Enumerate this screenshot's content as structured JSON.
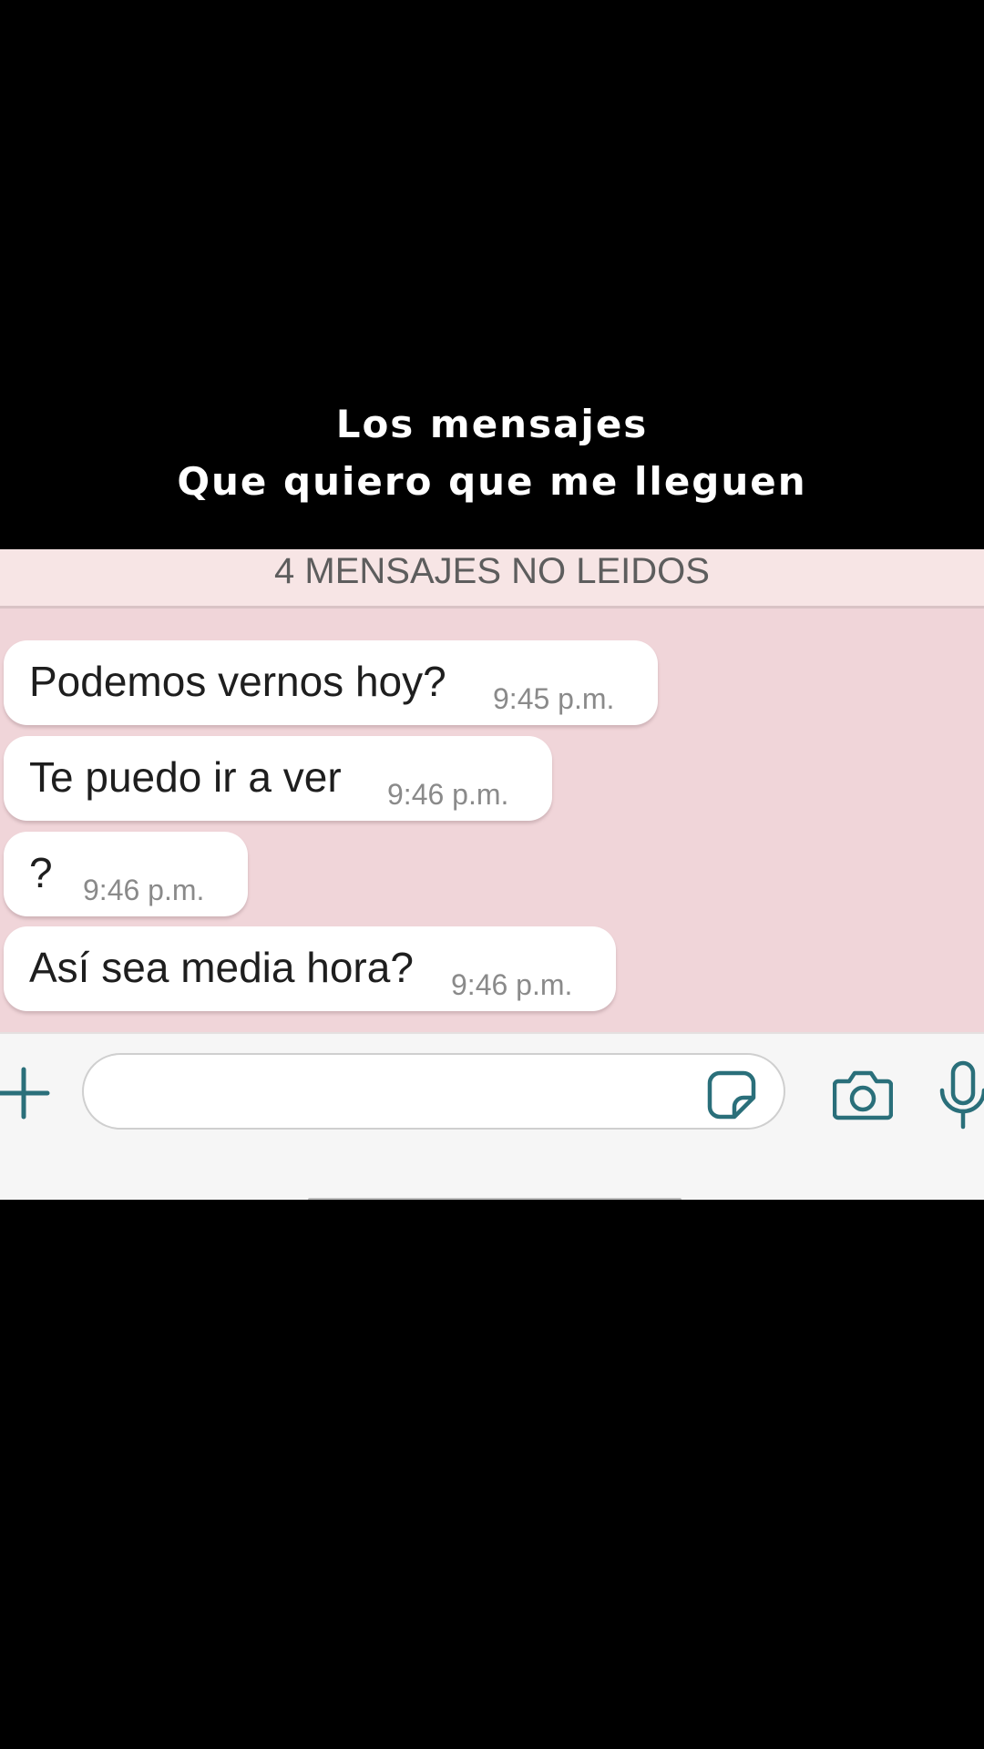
{
  "caption": {
    "line1": "Los mensajes",
    "line2": "Que quiero que me lleguen"
  },
  "chat": {
    "unread_banner": "4 MENSAJES NO LEIDOS",
    "messages": [
      {
        "text": "Podemos vernos hoy?",
        "time": "9:45 p.m."
      },
      {
        "text": "Te puedo ir a ver",
        "time": "9:46 p.m."
      },
      {
        "text": "?",
        "time": "9:46 p.m."
      },
      {
        "text": "Así sea media hora?",
        "time": "9:46 p.m."
      }
    ]
  },
  "composer": {
    "input_value": "",
    "icons": [
      "plus-icon",
      "sticker-icon",
      "camera-icon",
      "microphone-icon"
    ]
  },
  "colors": {
    "background": "#000000",
    "chat_background": "#f0d5d9",
    "bubble": "#ffffff",
    "icon_accent": "#2a6f7a"
  }
}
